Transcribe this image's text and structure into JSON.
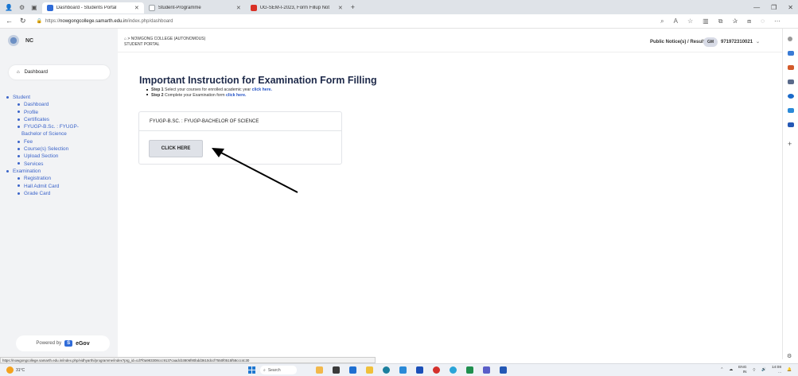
{
  "browser": {
    "tabs": [
      {
        "title": "Dashboard - Students Portal",
        "active": true,
        "color": "#2f6bd8"
      },
      {
        "title": "Student-Programme",
        "active": false,
        "color": "#9aa0a6"
      },
      {
        "title": "UG-SEM-I-2023, Form Fillup Not",
        "active": false,
        "color": "#d93025"
      }
    ],
    "new_tab": "+",
    "url_prefix": "https://",
    "url_domain": "nowgongcollege.samarth.edu.in",
    "url_path": "/index.php/dashboard"
  },
  "sidebar": {
    "brand": "NC",
    "dashboard_label": "Dashboard",
    "menu": [
      {
        "label": "Student",
        "level": 1
      },
      {
        "label": "Dashboard",
        "level": 2
      },
      {
        "label": "Profile",
        "level": 2
      },
      {
        "label": "Certificates",
        "level": 2
      },
      {
        "label": "FYUGP-B.Sc. : FYUGP-",
        "level": 2
      },
      {
        "label": "Bachelor of Science",
        "level": 3
      },
      {
        "label": "Fee",
        "level": 2
      },
      {
        "label": "Course(s) Selection",
        "level": 2
      },
      {
        "label": "Upload Section",
        "level": 2
      },
      {
        "label": "Services",
        "level": 2
      },
      {
        "label": "Examination",
        "level": 1
      },
      {
        "label": "Registration",
        "level": 2
      },
      {
        "label": "Hall Admit Card",
        "level": 2
      },
      {
        "label": "Grade Card",
        "level": 2
      }
    ],
    "powered_by": "Powered by",
    "egov_mark": "S",
    "egov_name": "eGov"
  },
  "header": {
    "breadcrumb_sep": ">",
    "college": "NOWGONG COLLEGE (AUTONOMOUS)",
    "portal": "STUDENT PORTAL",
    "notices": "Public Notice(s) / Results",
    "avatar_initials": "GM",
    "user_id": "971972310021"
  },
  "main": {
    "title": "Important Instruction for Examination Form Filling",
    "step1_label": "Step 1",
    "step1_text": "Select your courses for enrolled academic year",
    "step1_link": "click here.",
    "step2_label": "Step 2",
    "step2_text": "Complete your Examination form",
    "step2_link": "click here.",
    "programme": "FYUGP-B.SC. : FYUGP-BACHELOR OF SCIENCE",
    "button": "CLICK HERE"
  },
  "status_url": "https://nowgongcollege.samarth.edu.in/index.php/vidhyarthi/programme/index?prg_id=cd7f0a983308ccc9137caadcb3806f80bdd3610dccf7550f0515f58ccc4c30",
  "taskbar": {
    "weather": "31°C",
    "search": "Search",
    "lang": "ENG",
    "lang2": "IN",
    "time": "14:08",
    "date": "..."
  }
}
